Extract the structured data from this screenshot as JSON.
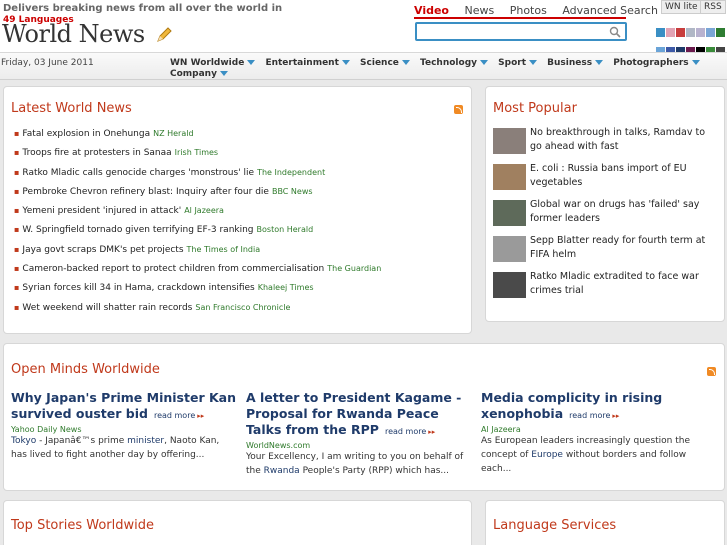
{
  "header": {
    "tagline": "Delivers breaking news from all over the world in",
    "languages": "49 Languages",
    "logo": "World News",
    "wn_lite": "WN lite",
    "rss": "RSS",
    "search_placeholder": "",
    "topnav": [
      "Video",
      "News",
      "Photos",
      "Advanced Search"
    ],
    "swatch_colors": [
      "#3a8fc4",
      "#e2a3b4",
      "#c83d3d",
      "#b0b7c6",
      "#b8b2cf",
      "#7aa6d6",
      "#2e7d32",
      "#6aa4d8",
      "#3d5aa8",
      "#1f3b6a",
      "#6b1a4e",
      "#000000",
      "#3a8b3a",
      "#444444"
    ]
  },
  "navbar": {
    "date": "Friday, 03 June 2011",
    "menu": [
      "WN Worldwide",
      "Entertainment",
      "Science",
      "Technology",
      "Sport",
      "Business",
      "Photographers",
      "Company"
    ]
  },
  "latest": {
    "title": "Latest World News",
    "items": [
      {
        "headline": "Fatal explosion in Onehunga",
        "source": "NZ Herald"
      },
      {
        "headline": "Troops fire at protesters in Sanaa",
        "source": "Irish Times"
      },
      {
        "headline": "Ratko Mladic calls genocide charges 'monstrous' lie",
        "source": "The Independent"
      },
      {
        "headline": "Pembroke Chevron refinery blast: Inquiry after four die",
        "source": "BBC News"
      },
      {
        "headline": "Yemeni president 'injured in attack'",
        "source": "Al Jazeera"
      },
      {
        "headline": "W. Springfield tornado given terrifying EF-3 ranking",
        "source": "Boston Herald"
      },
      {
        "headline": "Jaya govt scraps DMK's pet projects",
        "source": "The Times of India"
      },
      {
        "headline": "Cameron-backed report to protect children from commercialisation",
        "source": "The Guardian"
      },
      {
        "headline": "Syrian forces kill 34 in Hama, crackdown intensifies",
        "source": "Khaleej Times"
      },
      {
        "headline": "Wet weekend will shatter rain records",
        "source": "San Francisco Chronicle"
      }
    ]
  },
  "popular": {
    "title": "Most Popular",
    "items": [
      "No breakthrough in talks, Ramdav to go ahead with fast",
      "E. coli : Russia bans import of EU vegetables",
      "Global war on drugs has 'failed' say former leaders",
      "Sepp Blatter ready for fourth term at FIFA helm",
      "Ratko Mladic extradited to face war crimes trial"
    ]
  },
  "openminds": {
    "title": "Open Minds Worldwide",
    "read_more": "read more",
    "articles": [
      {
        "title": "Why Japan's Prime Minister Kan survived ouster bid",
        "source": "Yahoo Daily News",
        "body_a": "Tokyo",
        "body_b": " - Japanâ€™s prime ",
        "body_c": "minister",
        "body_d": ", Naoto Kan, has lived to fight another day by offering..."
      },
      {
        "title": "A letter to President Kagame - Proposal for Rwanda Peace Talks from the RPP",
        "source": "WorldNews.com",
        "body_a": "Your Excellency, I am writing to you on behalf of the ",
        "body_b": "Rwanda",
        "body_c": " People's Party (RPP) which has...",
        "body_d": ""
      },
      {
        "title": "Media complicity in rising xenophobia",
        "source": "Al Jazeera",
        "body_a": "As European leaders increasingly question the concept of ",
        "body_b": "Europe",
        "body_c": " without borders and follow each...",
        "body_d": ""
      }
    ]
  },
  "bottom": {
    "top_stories": "Top Stories Worldwide",
    "language_services": "Language Services"
  }
}
